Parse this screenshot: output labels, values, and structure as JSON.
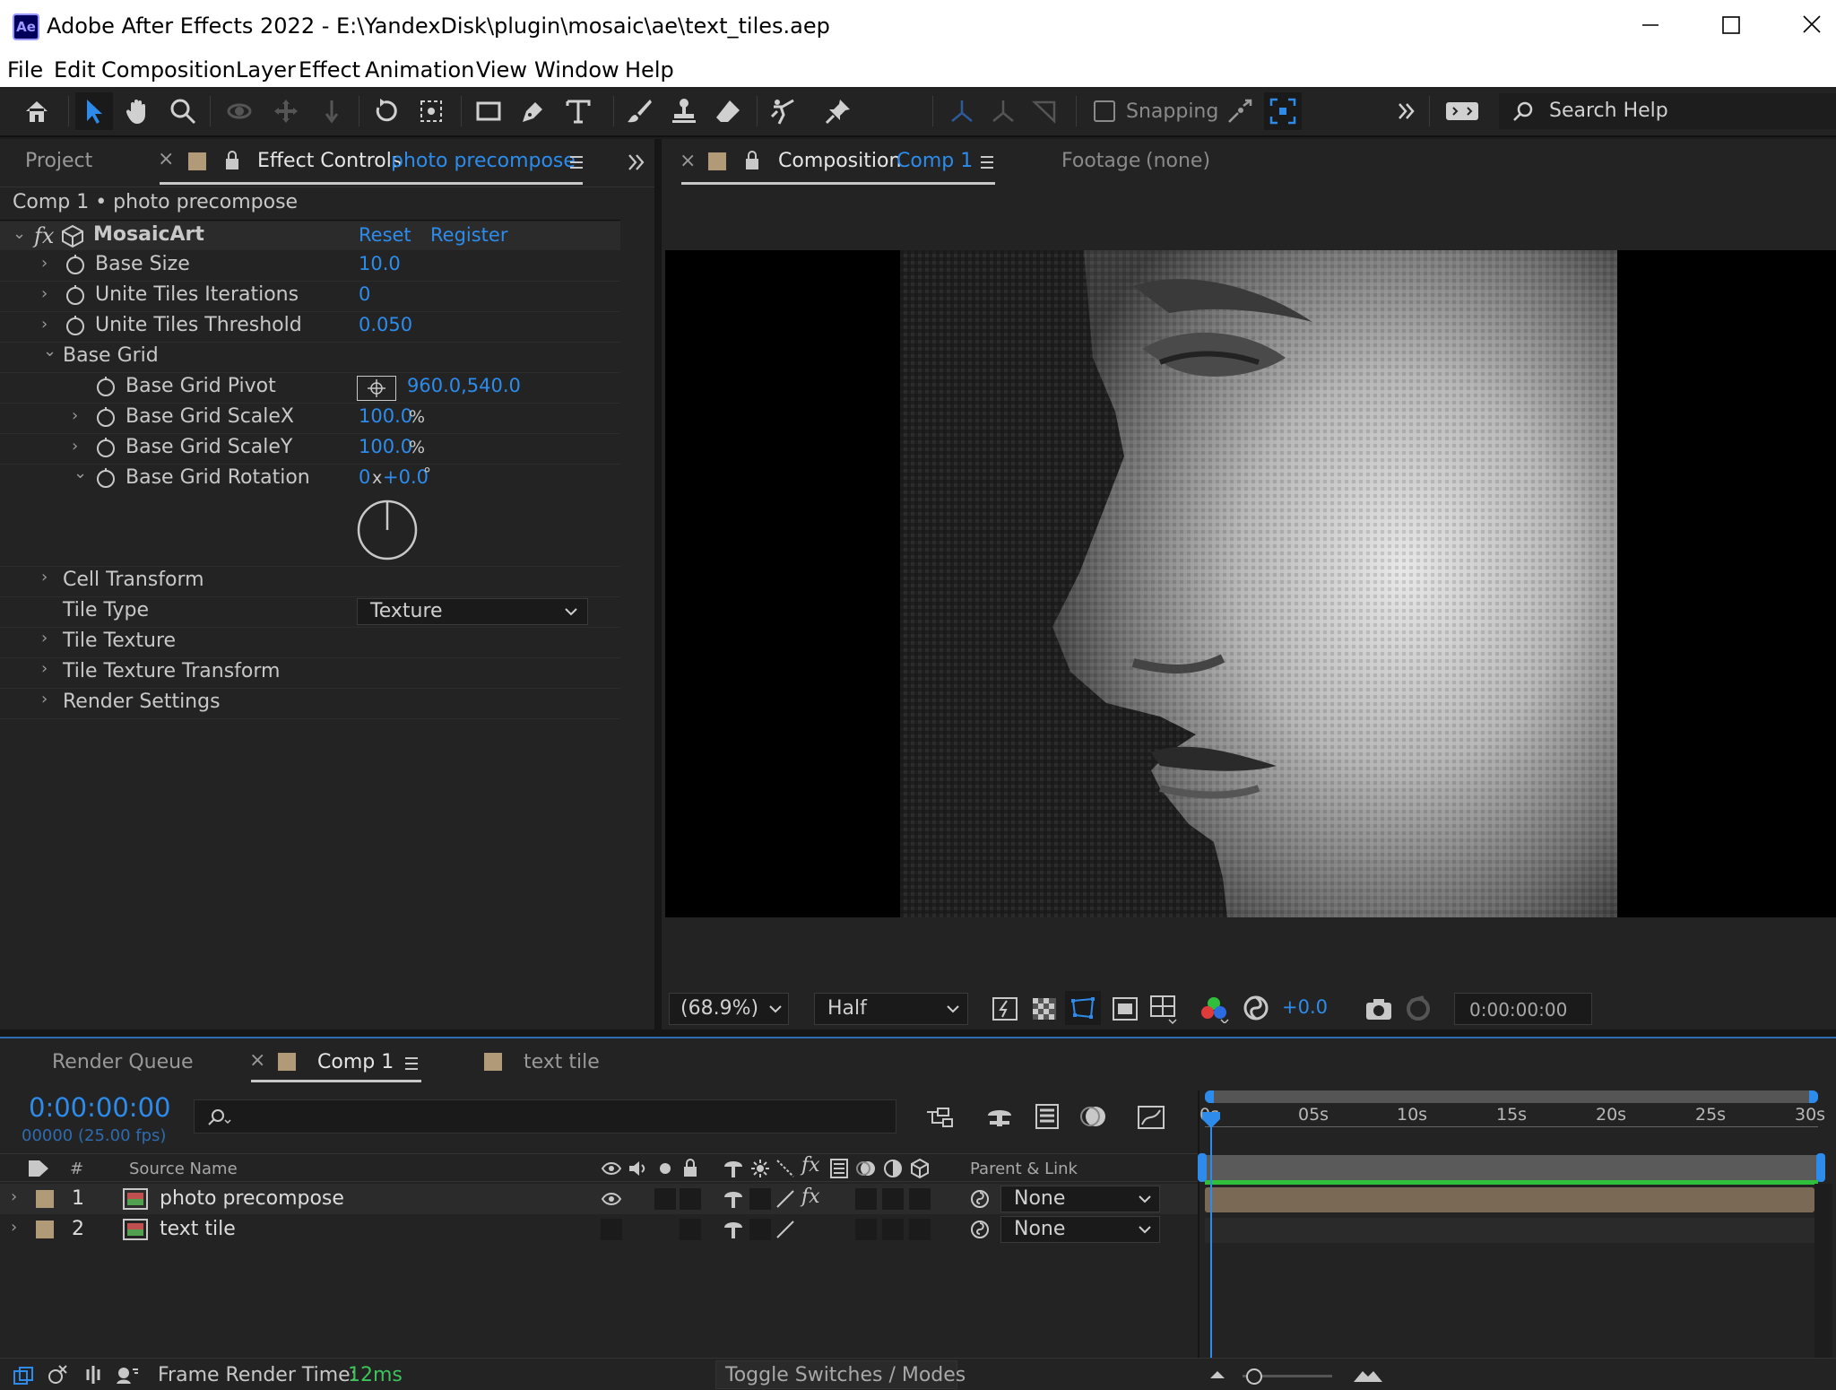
{
  "window": {
    "app_icon": "Ae",
    "title": "Adobe After Effects 2022 - E:\\YandexDisk\\plugin\\mosaic\\ae\\text_tiles.aep",
    "controls": [
      "minimize-icon",
      "maximize-icon",
      "close-icon"
    ]
  },
  "menu": [
    "File",
    "Edit",
    "Composition",
    "Layer",
    "Effect",
    "Animation",
    "View",
    "Window",
    "Help"
  ],
  "toolbar": {
    "tools": [
      "home-icon",
      "selection-tool-icon",
      "hand-tool-icon",
      "zoom-tool-icon",
      "orbit-camera-icon",
      "pan-camera-icon",
      "dolly-camera-icon",
      "rotation-tool-icon",
      "pan-behind-icon",
      "rectangle-tool-icon",
      "pen-tool-icon",
      "type-tool-icon",
      "brush-tool-icon",
      "clone-stamp-icon",
      "eraser-icon",
      "roto-brush-icon",
      "puppet-pin-icon"
    ],
    "snapping_label": "Snapping",
    "search_placeholder": "Search Help"
  },
  "left_panel": {
    "tab_project": "Project",
    "tab_effect_controls": "Effect Controls",
    "tab_effect_controls_target": "photo precompose",
    "breadcrumb": "Comp 1 • photo precompose",
    "effect": {
      "name": "MosaicArt",
      "reset": "Reset",
      "register": "Register"
    },
    "props": {
      "base_size": {
        "label": "Base Size",
        "value": "10.0"
      },
      "unite_iter": {
        "label": "Unite Tiles Iterations",
        "value": "0"
      },
      "unite_thresh": {
        "label": "Unite Tiles Threshold",
        "value": "0.050"
      },
      "base_grid": {
        "label": "Base Grid"
      },
      "pivot": {
        "label": "Base Grid Pivot",
        "value": "960.0,540.0"
      },
      "scale_x": {
        "label": "Base Grid ScaleX",
        "value": "100.0",
        "unit": "%"
      },
      "scale_y": {
        "label": "Base Grid ScaleY",
        "value": "100.0",
        "unit": "%"
      },
      "rotation": {
        "label": "Base Grid Rotation",
        "rev": "0",
        "x": "x",
        "deg": "+0.0",
        "deg_unit": "°"
      },
      "cell_transform": {
        "label": "Cell Transform"
      },
      "tile_type": {
        "label": "Tile Type",
        "value": "Texture"
      },
      "tile_texture": {
        "label": "Tile Texture"
      },
      "tile_texture_transform": {
        "label": "Tile Texture Transform"
      },
      "render_settings": {
        "label": "Render Settings"
      }
    }
  },
  "comp_panel": {
    "tab_label": "Composition",
    "tab_target": "Comp 1",
    "footage_label": "Footage",
    "footage_value": "(none)",
    "zoom": "(68.9%)",
    "resolution": "Half",
    "exposure": "+0.0",
    "timecode": "0:00:00:00"
  },
  "timeline": {
    "tab_render_queue": "Render Queue",
    "tab_comp": "Comp 1",
    "tab_text_tile": "text tile",
    "timecode": "0:00:00:00",
    "frame_info": "00000 (25.00 fps)",
    "headers": {
      "num": "#",
      "source_name": "Source Name",
      "parent": "Parent & Link"
    },
    "ruler": [
      "0s",
      "05s",
      "10s",
      "15s",
      "20s",
      "25s",
      "30s"
    ],
    "layers": [
      {
        "num": "1",
        "name": "photo precompose",
        "parent": "None"
      },
      {
        "num": "2",
        "name": "text tile",
        "parent": "None"
      }
    ],
    "footer": {
      "render_time_label": "Frame Render Time:",
      "render_time_value": "12ms",
      "toggle": "Toggle Switches / Modes"
    }
  },
  "colors": {
    "accent": "#2d8ceb",
    "label_swatch": "#b09a78",
    "work_area": "#2fbf3a",
    "layer_bar": "#7a6a55"
  }
}
